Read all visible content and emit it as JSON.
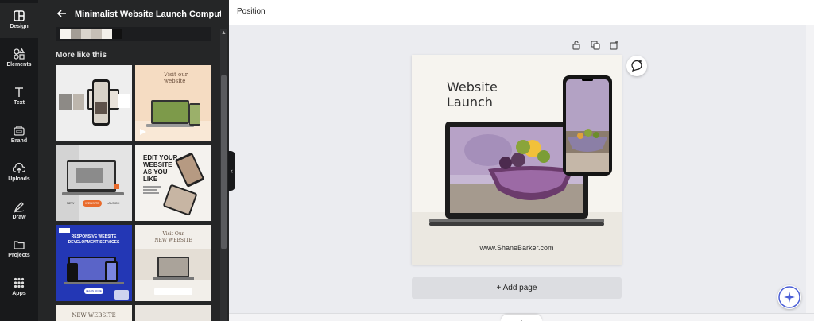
{
  "rail": {
    "items": [
      {
        "label": "Design",
        "icon": "design-icon"
      },
      {
        "label": "Elements",
        "icon": "elements-icon"
      },
      {
        "label": "Text",
        "icon": "text-icon"
      },
      {
        "label": "Brand",
        "icon": "brand-icon"
      },
      {
        "label": "Uploads",
        "icon": "uploads-icon"
      },
      {
        "label": "Draw",
        "icon": "draw-icon"
      },
      {
        "label": "Projects",
        "icon": "projects-icon"
      },
      {
        "label": "Apps",
        "icon": "apps-icon"
      }
    ]
  },
  "panel": {
    "title": "Minimalist Website Launch Computer ...",
    "palette": [
      "#f6f4ef",
      "#a39d95",
      "#d9d4cc",
      "#c6bfb6",
      "#f2efe9",
      "#111111"
    ],
    "more_title": "More like this"
  },
  "thumbs": [
    {
      "name": "template-thumb-1",
      "texts": []
    },
    {
      "name": "template-thumb-2",
      "texts": [
        "Visit our",
        "website"
      ]
    },
    {
      "name": "template-thumb-3",
      "texts": [
        "NEW",
        "WEBSITE",
        "LAUNCH"
      ]
    },
    {
      "name": "template-thumb-4",
      "texts": [
        "EDIT YOUR",
        "WEBSITE",
        "AS YOU",
        "LIKE"
      ]
    },
    {
      "name": "template-thumb-5",
      "texts": [
        "RESPONSIVE WEBSITE",
        "DEVELOPMENT SERVICES",
        "LEARN MORE"
      ]
    },
    {
      "name": "template-thumb-6",
      "texts": [
        "Visit Our",
        "NEW WEBSITE"
      ]
    },
    {
      "name": "template-thumb-7",
      "texts": [
        "NEW WEBSITE"
      ]
    }
  ],
  "topbar": {
    "position_label": "Position"
  },
  "design": {
    "heading_line1": "Website",
    "heading_line2": "Launch",
    "url": "www.ShaneBarker.com"
  },
  "add_page_label": "+ Add page",
  "colors": {
    "rail_bg": "#18191b",
    "panel_bg": "#252627",
    "canvas_bg": "#ebecf0",
    "accent": "#7d2ae8"
  }
}
